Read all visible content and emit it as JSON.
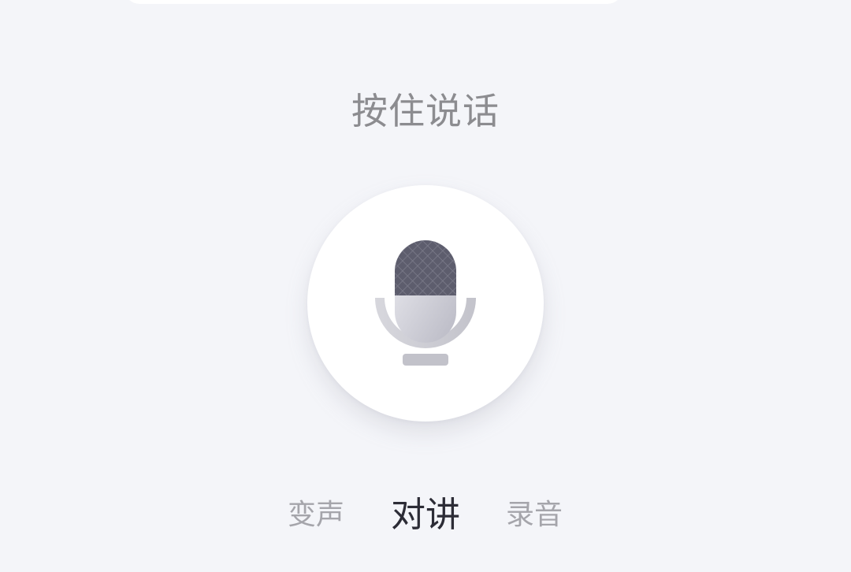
{
  "hint": {
    "text": "按住说话"
  },
  "mic": {
    "icon": "microphone-icon"
  },
  "mode_tabs": [
    {
      "label": "变声",
      "active": false
    },
    {
      "label": "对讲",
      "active": true
    },
    {
      "label": "录音",
      "active": false
    }
  ],
  "colors": {
    "background": "#f4f5f9",
    "active_tab": "#2c2c36",
    "inactive_tab": "#a5a5ab",
    "hint_text": "#8c8c90",
    "mic_head": "#5a5a6a"
  }
}
